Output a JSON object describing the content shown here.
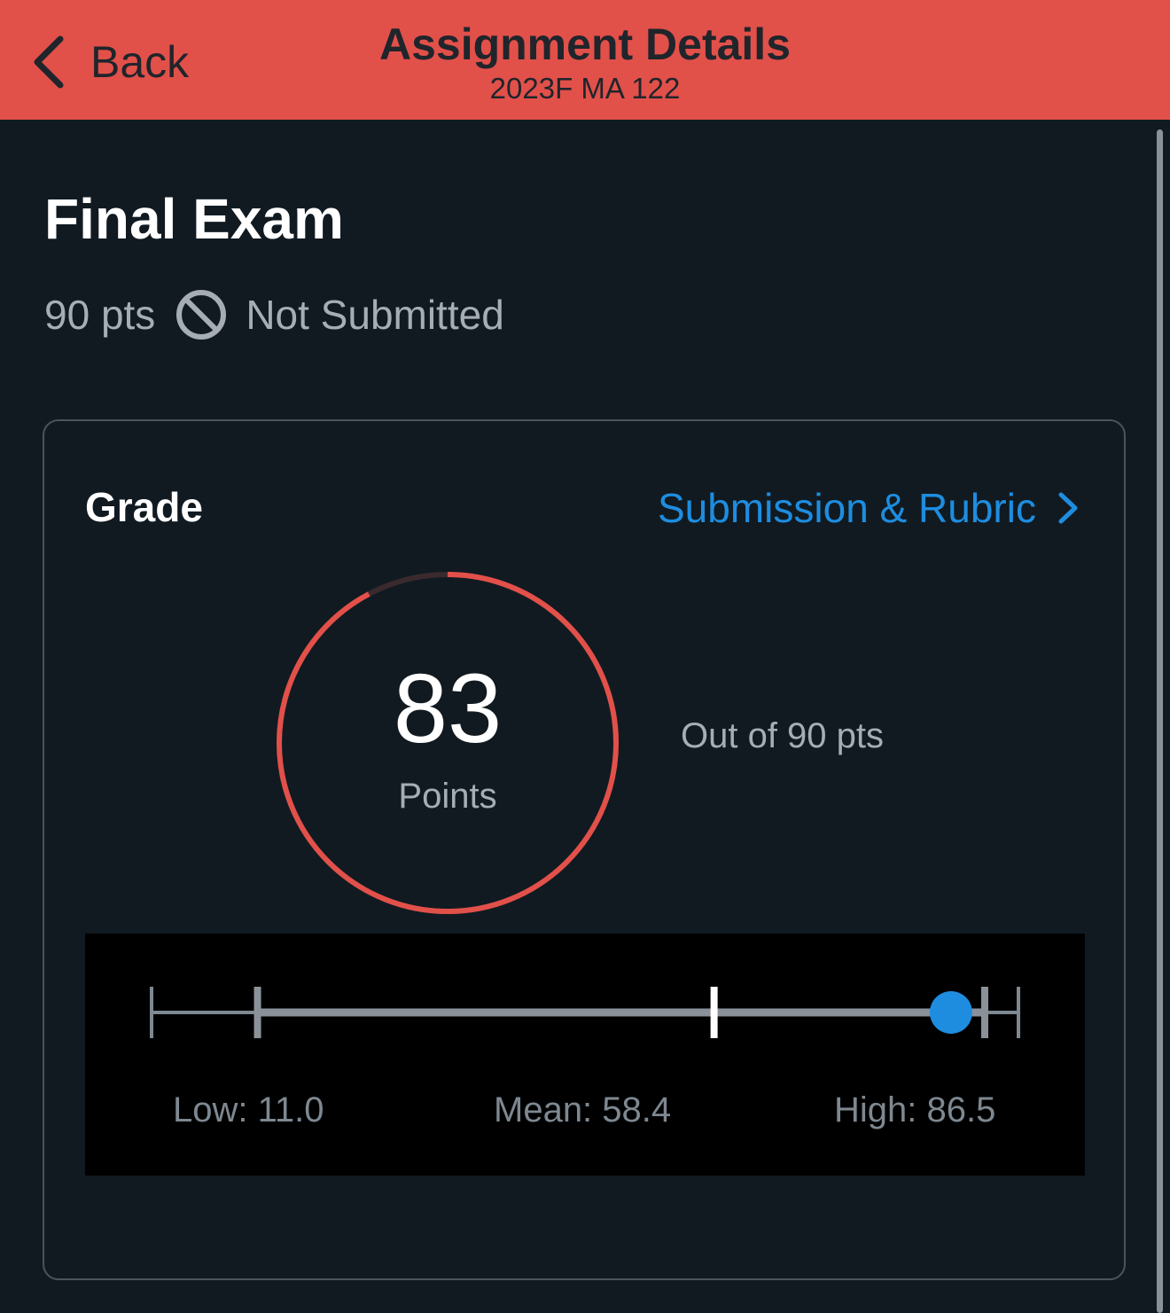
{
  "navbar": {
    "back_label": "Back",
    "title": "Assignment Details",
    "subtitle": "2023F MA 122",
    "color": "#e2504a"
  },
  "assignment": {
    "title": "Final Exam",
    "points_possible_label": "90 pts",
    "submission_status": "Not Submitted",
    "status_icon": "ban-icon"
  },
  "grade": {
    "label": "Grade",
    "link_label": "Submission & Rubric",
    "link_icon": "chevron-right-icon",
    "score": "83",
    "score_unit": "Points",
    "out_of": "Out of 90 pts",
    "score_value": 83,
    "points_possible": 90,
    "ring_color": "#e2504a"
  },
  "stats": {
    "low_label": "Low: 11.0",
    "mean_label": "Mean: 58.4",
    "high_label": "High: 86.5",
    "low": 11.0,
    "mean": 58.4,
    "high": 86.5,
    "score": 83,
    "marker_color": "#1e8de0"
  }
}
